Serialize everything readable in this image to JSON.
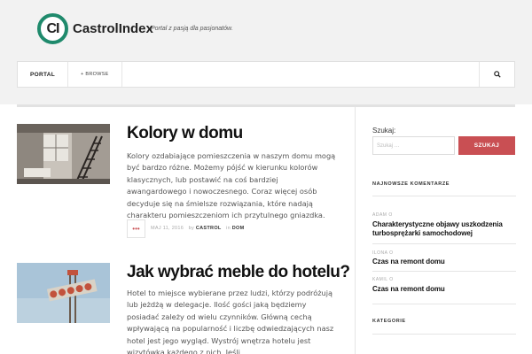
{
  "site": {
    "logo_mark": "CI",
    "name_part1": "Castrol",
    "name_part2": "Index",
    "tagline": "Portal z pasją dla pasjonatów."
  },
  "nav": {
    "portal": "PORTAL",
    "browse": "+ BROWSE"
  },
  "articles": [
    {
      "title": "Kolory w domu",
      "body": "Kolory ozdabiające pomieszczenia w naszym domu mogą być bardzo różne. Możemy pójść w kierunku kolorów klasycznych, lub postawić na coś bardziej awangardowego i nowoczesnego. Coraz więcej osób decyduje się na śmielsze rozwiązania, które nadają charakteru pomieszczeniom ich przytulnego gniazdka.",
      "date": "MAJ 11, 2016",
      "by": "by",
      "author": "CASTROL",
      "in": "in",
      "category": "DOM"
    },
    {
      "title": "Jak wybrać meble do hotelu?",
      "body": "Hotel to miejsce wybierane przez ludzi, którzy podróżują lub jeżdżą w delegacje. Ilość gości jaką będziemy posiadać zależy od wielu  czynników. Główną cechą wpływającą na popularność i liczbę odwiedzających nasz hotel jest jego wygląd. Wystrój wnętrza hotelu jest wizytówką każdego z nich. Jeśli"
    }
  ],
  "sidebar": {
    "search_label": "Szukaj:",
    "search_placeholder": "Szukaj …",
    "search_button": "SZUKAJ",
    "comments_title": "NAJNOWSZE KOMENTARZE",
    "comments": [
      {
        "author": "ADAM O",
        "link": "Charakterystyczne objawy uszkodzenia turbosprężarki samochodowej"
      },
      {
        "author": "ILONA O",
        "link": "Czas na remont domu"
      },
      {
        "author": "KAMIL O",
        "link": "Czas na remont domu"
      }
    ],
    "categories_title": "KATEGORIE"
  },
  "colors": {
    "brand_green": "#1f8a6c",
    "button_red": "#c94f53"
  }
}
